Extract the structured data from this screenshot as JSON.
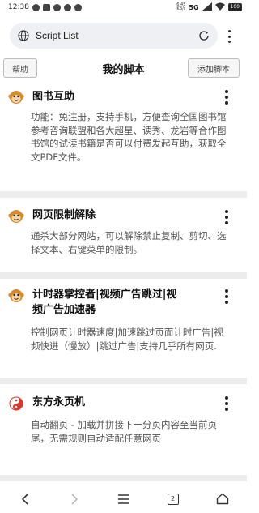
{
  "status": {
    "time": "12:38",
    "mini_left": "6.45",
    "mini_right": "KB/s",
    "network": "5G",
    "battery": "100"
  },
  "browser": {
    "url": "Script List",
    "tab_count": "2"
  },
  "header": {
    "help_label": "帮助",
    "title": "我的脚本",
    "add_label": "添加脚本"
  },
  "scripts": [
    {
      "title": "图书互助",
      "description": "功能：免注册，支持手机，方便查询全国图书馆参考咨询联盟和各大超星、读秀、龙岩等合作图书馆的试读书籍是否可以付费发起互助，获取全文PDF文件。",
      "icon": "monkey-icon"
    },
    {
      "title": "网页限制解除",
      "description": "通杀大部分网站，可以解除禁止复制、剪切、选择文本、右键菜单的限制。",
      "icon": "monkey-icon"
    },
    {
      "title": "计时器掌控者|视频广告跳过|视频广告加速器",
      "title_line1": "计时器掌控者|视频广告跳过|视",
      "title_line2": "频广告加速器",
      "description": "控制网页计时器速度|加速跳过页面计时广告|视频快进（慢放）|跳过广告|支持几乎所有网页.",
      "icon": "monkey-icon"
    },
    {
      "title": "东方永页机",
      "description": "自动翻页 - 加载并拼接下一分页内容至当前页尾，无需规则自动适配任意网页",
      "icon": "yin-yang-icon"
    }
  ],
  "colors": {
    "separator": "#ececec",
    "url_bar": "#eff0f4",
    "monkey_face": "#d68a2c"
  }
}
